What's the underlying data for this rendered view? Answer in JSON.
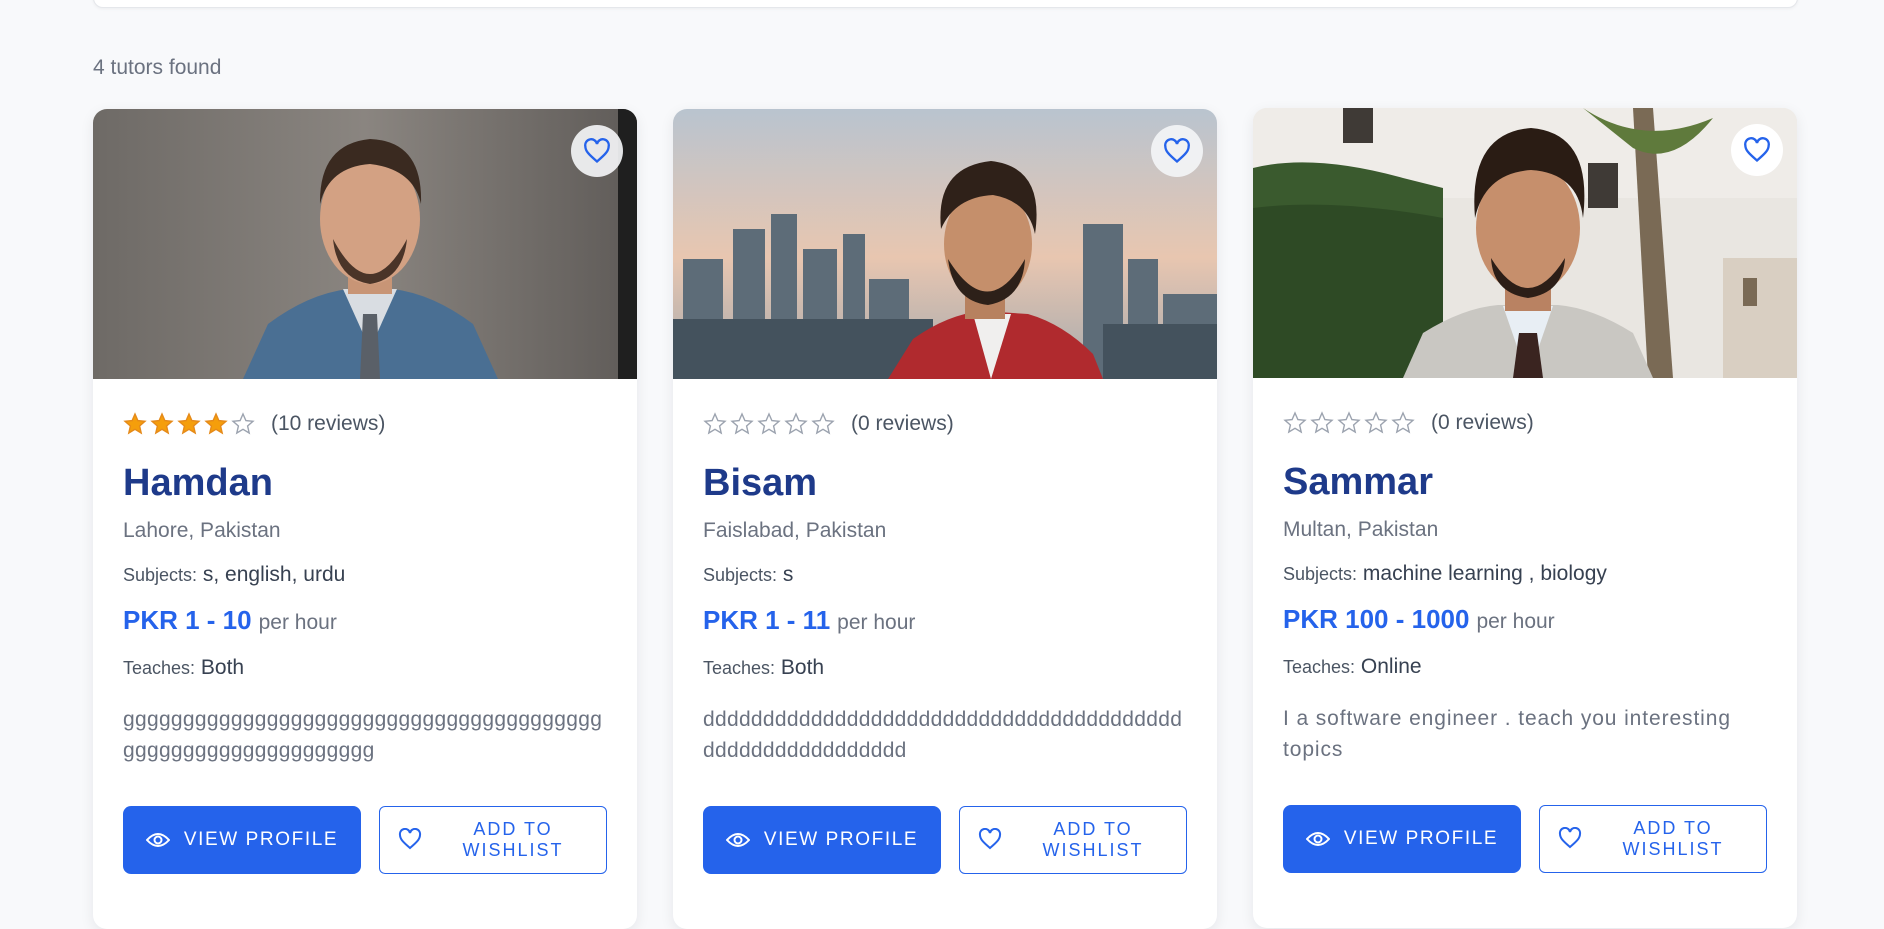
{
  "results": {
    "count_text": "4 tutors found"
  },
  "colors": {
    "accent": "#2563eb",
    "name": "#1e3a8a",
    "star_filled": "#f59e0b"
  },
  "tutors": [
    {
      "name": "Hamdan",
      "rating": 4,
      "reviews": "(10 reviews)",
      "location": "Lahore, Pakistan",
      "subjects_label": "Subjects:",
      "subjects": "s, english, urdu",
      "price": "PKR 1 - 10",
      "per": "per hour",
      "teaches_label": "Teaches:",
      "teaches": "Both",
      "description": "ggggggggggggggggggggggggggggggggggggggggggggggggggggggggggggg",
      "view_label": "VIEW PROFILE",
      "wishlist_label": "ADD TO WISHLIST"
    },
    {
      "name": "Bisam",
      "rating": 0,
      "reviews": "(0 reviews)",
      "location": "Faislabad, Pakistan",
      "subjects_label": "Subjects:",
      "subjects": "s",
      "price": "PKR 1 - 11",
      "per": "per hour",
      "teaches_label": "Teaches:",
      "teaches": "Both",
      "description": "ddddddddddddddddddddddddddddddddddddddddddddddddddddddddd",
      "view_label": "VIEW PROFILE",
      "wishlist_label": "ADD TO WISHLIST"
    },
    {
      "name": "Sammar",
      "rating": 0,
      "reviews": "(0 reviews)",
      "location": "Multan, Pakistan",
      "subjects_label": "Subjects:",
      "subjects": "machine learning , biology",
      "price": "PKR 100 - 1000",
      "per": "per hour",
      "teaches_label": "Teaches:",
      "teaches": "Online",
      "description": "I a software engineer . teach you interesting topics",
      "view_label": "VIEW PROFILE",
      "wishlist_label": "ADD TO WISHLIST"
    }
  ]
}
